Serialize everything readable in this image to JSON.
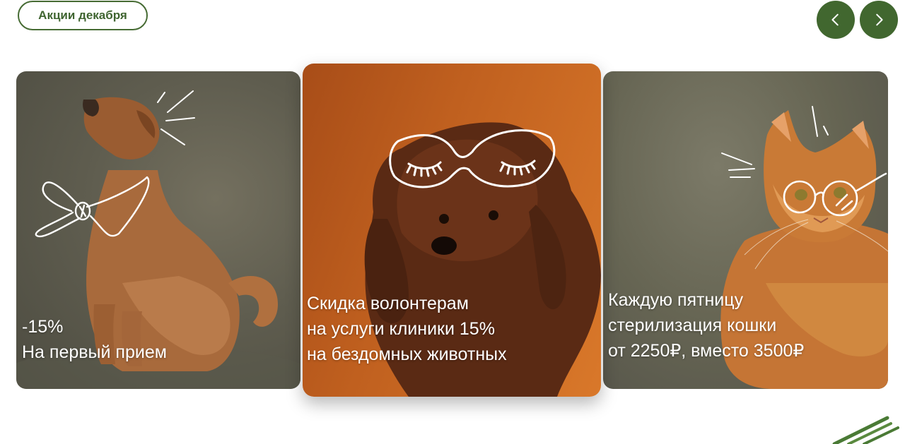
{
  "header": {
    "promo_button_label": "Акции декабря",
    "prev_icon": "chevron-left-icon",
    "next_icon": "chevron-right-icon"
  },
  "colors": {
    "brand_green": "#41672f",
    "card_orange": "#c0601f",
    "card_olive": "#5f5d4f"
  },
  "slides": [
    {
      "lines": [
        "-15%",
        "На первый прием"
      ],
      "image": "dog-with-bow-tie-illustration"
    },
    {
      "lines": [
        "Скидка волонтерам",
        "на услуги клиники 15%",
        "на бездомных животных"
      ],
      "image": "poodle-with-sleep-mask-illustration"
    },
    {
      "lines": [
        "Каждую пятницу",
        "стерилизация кошки",
        "от 2250₽, вместо 3500₽"
      ],
      "image": "cat-with-glasses-illustration"
    }
  ]
}
